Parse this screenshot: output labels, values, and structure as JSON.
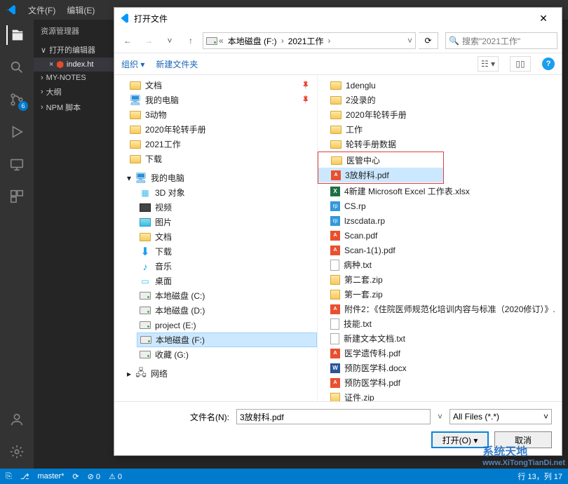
{
  "vscode": {
    "menu_file": "文件(F)",
    "menu_edit": "编辑(E)",
    "sidebar_title": "资源管理器",
    "open_editors": "打开的编辑器",
    "tab_filename": "index.ht",
    "sec_mynotes": "MY-NOTES",
    "sec_outline": "大纲",
    "sec_npm": "NPM 脚本",
    "scm_badge": "6",
    "status_branch": "master*",
    "status_sync": "⟳",
    "status_err": "⊘ 0",
    "status_warn": "⚠ 0",
    "status_pos": "行 13，列 17"
  },
  "dialog": {
    "title": "打开文件",
    "breadcrumb_drive": "本地磁盘 (F:)",
    "breadcrumb_folder": "2021工作",
    "search_placeholder": "搜索\"2021工作\"",
    "toolbar_organize": "组织",
    "toolbar_newfolder": "新建文件夹",
    "filename_label": "文件名(N):",
    "filename_value": "3放射科.pdf",
    "filter_value": "All Files (*.*)",
    "btn_open": "打开(O)",
    "btn_cancel": "取消"
  },
  "quick_access": [
    {
      "label": "文档",
      "icon": "folder",
      "pinned": true
    },
    {
      "label": "我的电脑",
      "icon": "pc",
      "pinned": true
    },
    {
      "label": "3动物",
      "icon": "folder"
    },
    {
      "label": "2020年轮转手册",
      "icon": "folder"
    },
    {
      "label": "2021工作",
      "icon": "folder"
    },
    {
      "label": "下载",
      "icon": "folder"
    }
  ],
  "this_pc_label": "我的电脑",
  "this_pc": [
    {
      "label": "3D 对象",
      "icon": "3d"
    },
    {
      "label": "视频",
      "icon": "video"
    },
    {
      "label": "图片",
      "icon": "pic"
    },
    {
      "label": "文档",
      "icon": "folder"
    },
    {
      "label": "下载",
      "icon": "down"
    },
    {
      "label": "音乐",
      "icon": "music"
    },
    {
      "label": "桌面",
      "icon": "desktop"
    },
    {
      "label": "本地磁盘 (C:)",
      "icon": "drive"
    },
    {
      "label": "本地磁盘 (D:)",
      "icon": "drive"
    },
    {
      "label": "project (E:)",
      "icon": "drive"
    },
    {
      "label": "本地磁盘 (F:)",
      "icon": "drive",
      "selected": true
    },
    {
      "label": "收藏 (G:)",
      "icon": "drive"
    }
  ],
  "network_label": "网络",
  "files": [
    {
      "label": "1denglu",
      "icon": "folder"
    },
    {
      "label": "2没录的",
      "icon": "folder"
    },
    {
      "label": "2020年轮转手册",
      "icon": "folder"
    },
    {
      "label": "工作",
      "icon": "folder"
    },
    {
      "label": "轮转手册数据",
      "icon": "folder"
    },
    {
      "label": "医管中心",
      "icon": "folder",
      "redbox": "start"
    },
    {
      "label": "3放射科.pdf",
      "icon": "pdf",
      "selected": true,
      "redbox": "end"
    },
    {
      "label": "4新建 Microsoft Excel 工作表.xlsx",
      "icon": "excel"
    },
    {
      "label": "CS.rp",
      "icon": "axure"
    },
    {
      "label": "lzscdata.rp",
      "icon": "axure"
    },
    {
      "label": "Scan.pdf",
      "icon": "pdf"
    },
    {
      "label": "Scan-1(1).pdf",
      "icon": "pdf"
    },
    {
      "label": "病种.txt",
      "icon": "txt"
    },
    {
      "label": "第二套.zip",
      "icon": "zip"
    },
    {
      "label": "第一套.zip",
      "icon": "zip"
    },
    {
      "label": "附件2：《住院医师规范化培训内容与标准（2020修订）》.",
      "icon": "pdf"
    },
    {
      "label": "技能.txt",
      "icon": "txt"
    },
    {
      "label": "新建文本文档.txt",
      "icon": "txt"
    },
    {
      "label": "医学遗传科.pdf",
      "icon": "pdf"
    },
    {
      "label": "预防医学科.docx",
      "icon": "word"
    },
    {
      "label": "预防医学科.pdf",
      "icon": "pdf"
    },
    {
      "label": "证件.zip",
      "icon": "zip"
    }
  ],
  "watermark": {
    "cn": "系统天地",
    "url": "www.XiTongTianDi.net"
  }
}
